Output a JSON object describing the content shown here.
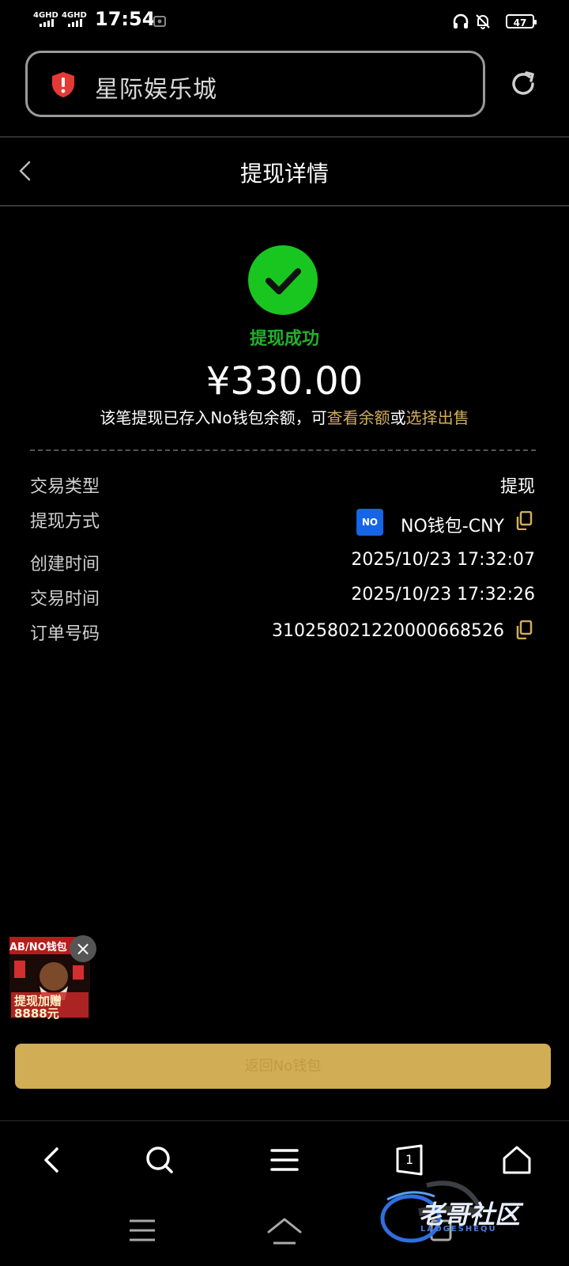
{
  "status_bar": {
    "network1": "4GHD",
    "network2": "4GHD",
    "time": "17:54",
    "battery": "47"
  },
  "browser": {
    "site_title": "星际娱乐城"
  },
  "header": {
    "title": "提现详情"
  },
  "result": {
    "status": "提现成功",
    "amount": "¥330.00",
    "note_prefix": "该笔提现已存入No钱包余额，可",
    "link_balance": "查看余额",
    "note_or": "或",
    "link_sell": "选择出售"
  },
  "details": {
    "type_label": "交易类型",
    "type_value": "提现",
    "method_label": "提现方式",
    "method_value": "NO钱包-CNY",
    "method_logo": "NO",
    "created_label": "创建时间",
    "created_value": "2025/10/23 17:32:07",
    "trade_time_label": "交易时间",
    "trade_time_value": "2025/10/23 17:32:26",
    "order_label": "订单号码",
    "order_value": "310258021220000668526"
  },
  "promo": {
    "top_text": "AB/NO钱包",
    "main_text": "提现加赠",
    "amount_text": "8888元"
  },
  "cta": {
    "label": "返回No钱包"
  },
  "bottom_nav": {
    "tab_count": "1"
  },
  "watermark": {
    "text": "老哥社区",
    "sub": "LAOGESHEQU"
  },
  "colors": {
    "success": "#18c61f",
    "gold": "#d1ad5a",
    "button": "#d1ad55",
    "background": "#000000"
  }
}
